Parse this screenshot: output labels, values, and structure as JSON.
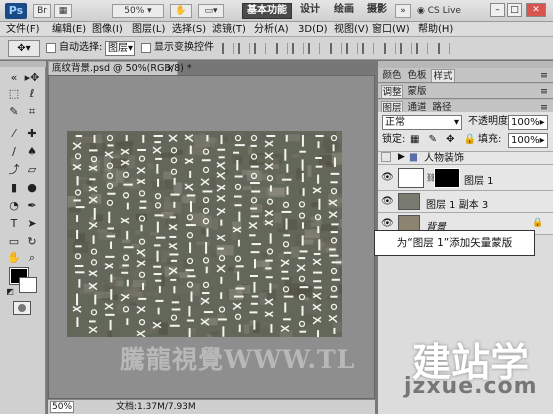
{
  "titlebar": {
    "zoom": "50%",
    "workspaces": [
      "基本功能",
      "设计",
      "绘画",
      "摄影"
    ],
    "cs_live": "CS Live"
  },
  "menu": [
    "文件(F)",
    "编辑(E)",
    "图像(I)",
    "图层(L)",
    "选择(S)",
    "滤镜(T)",
    "分析(A)",
    "3D(D)",
    "视图(V)",
    "窗口(W)",
    "帮助(H)"
  ],
  "options": {
    "auto_select_label": "自动选择:",
    "auto_select_value": "图层",
    "show_transform_label": "显示变换控件"
  },
  "document": {
    "tab_title": "底纹背景.psd @ 50%(RGB/8) *",
    "zoom": "50%",
    "doc_size": "文档:1.37M/7.93M"
  },
  "panels": {
    "top_tabs": [
      "颜色",
      "色板",
      "样式"
    ],
    "mid_tabs": [
      "调整",
      "蒙版"
    ],
    "layer_tabs": [
      "图层",
      "通道",
      "路径"
    ],
    "blend_mode": "正常",
    "opacity_label": "不透明度:",
    "opacity_value": "100%",
    "lock_label": "锁定:",
    "fill_label": "填充:",
    "fill_value": "100%",
    "layers": [
      {
        "name": "人物装饰",
        "type": "group"
      },
      {
        "name": "图层 1",
        "type": "masked"
      },
      {
        "name": "图层 1 副本 3",
        "type": "texture"
      },
      {
        "name": "背景",
        "type": "background"
      }
    ]
  },
  "callout": "为“图层 1”添加矢量蒙版",
  "watermark": {
    "line1": "騰龍視覺WWW.TL",
    "line2": "建站学",
    "line3": "jzxue.com"
  },
  "icons": {
    "ps_logo": "Ps",
    "eye": "eye-icon",
    "lock": "lock-icon",
    "folder": "folder-icon"
  }
}
